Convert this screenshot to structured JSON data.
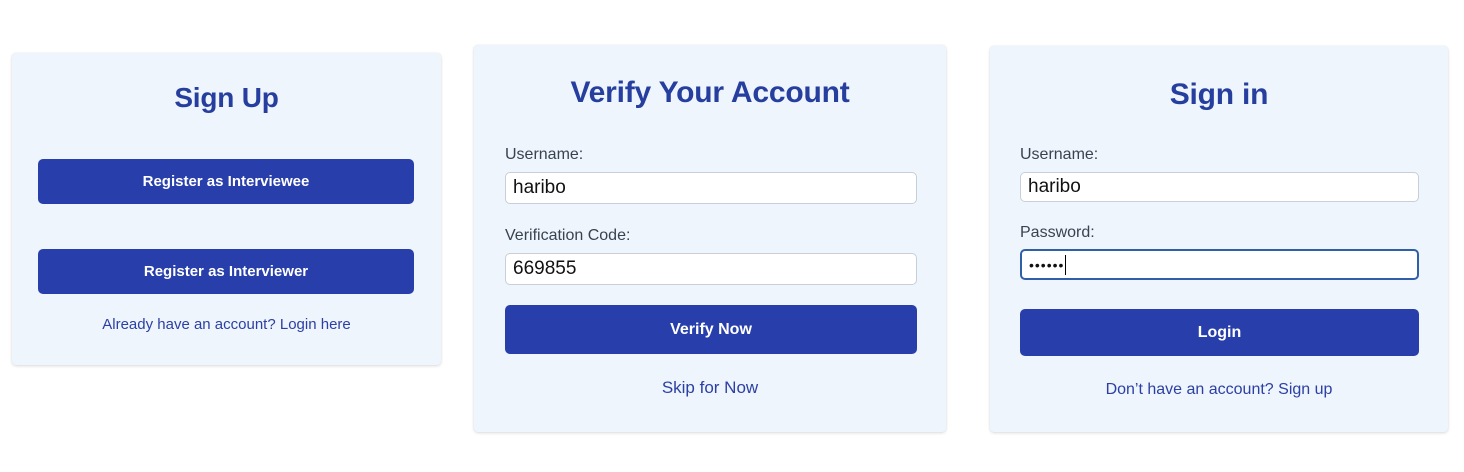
{
  "signup": {
    "title": "Sign Up",
    "register_interviewee": "Register as Interviewee",
    "register_interviewer": "Register as Interviewer",
    "login_link": "Already have an account? Login here"
  },
  "verify": {
    "title": "Verify Your Account",
    "username_label": "Username:",
    "username_value": "haribo",
    "code_label": "Verification Code:",
    "code_value": "669855",
    "verify_button": "Verify Now",
    "skip_link": "Skip for Now"
  },
  "signin": {
    "title": "Sign in",
    "username_label": "Username:",
    "username_value": "haribo",
    "password_label": "Password:",
    "password_value": "••••••",
    "login_button": "Login",
    "signup_link": "Don’t have an account? Sign up"
  },
  "colors": {
    "card_bg": "#eef5fd",
    "primary": "#283fab",
    "title": "#263e9e",
    "focus_border": "#2f5fa8"
  }
}
